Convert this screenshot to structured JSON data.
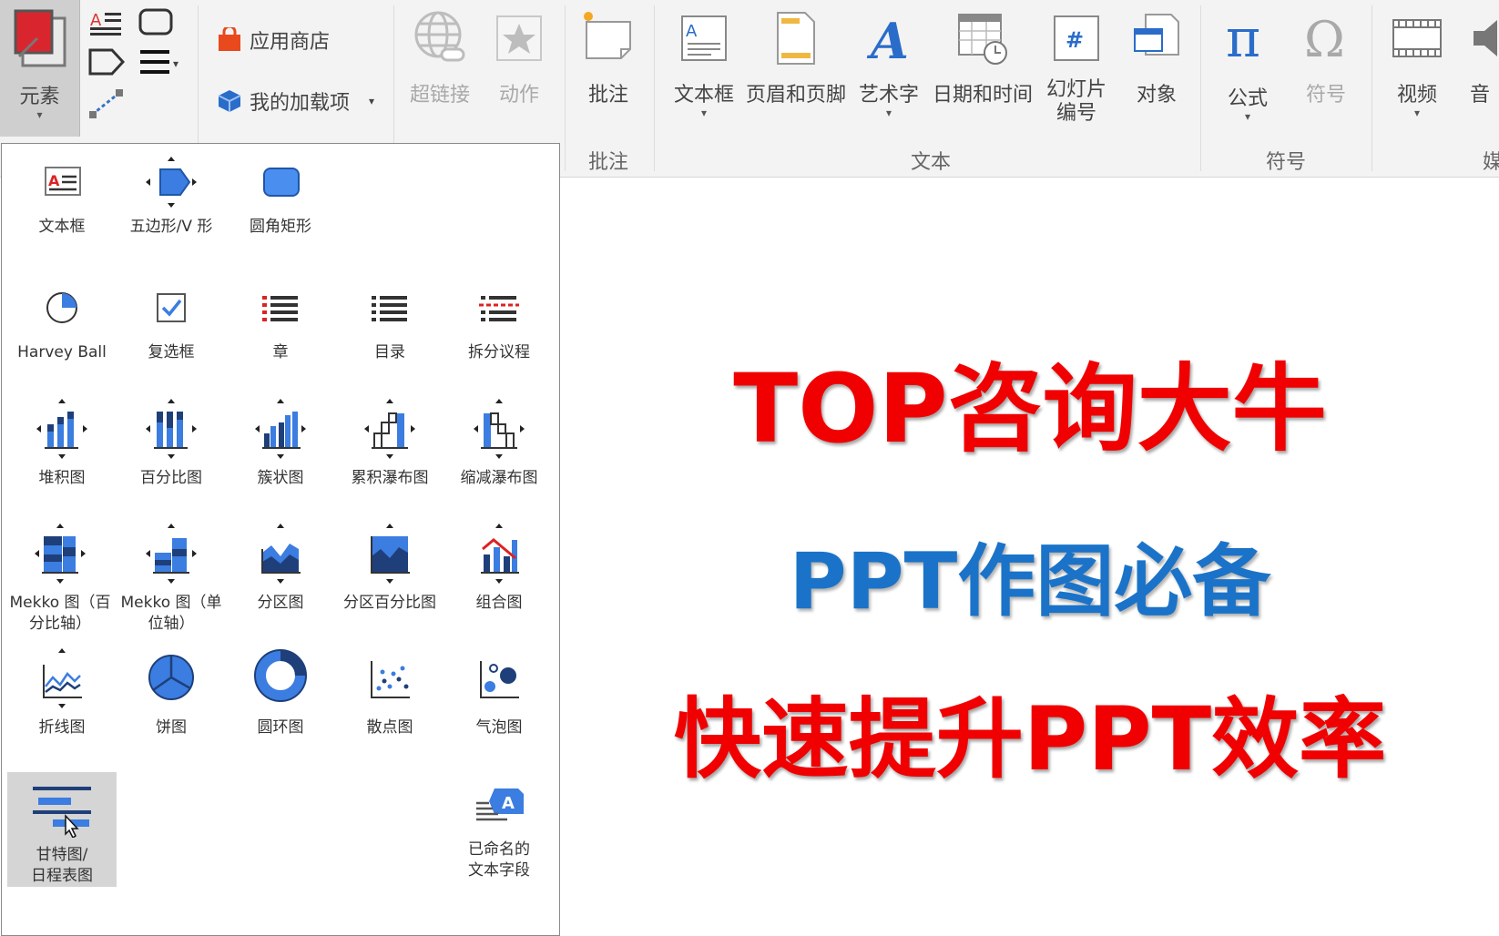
{
  "ribbon": {
    "elements_label": "元素",
    "app_store_label": "应用商店",
    "my_addins_label": "我的加载项",
    "hyperlink_label": "超链接",
    "action_label": "动作",
    "comment_label": "批注",
    "comment_group": "批注",
    "textbox_label": "文本框",
    "header_footer_label": "页眉和页脚",
    "wordart_label": "艺术字",
    "datetime_label": "日期和时间",
    "slide_number_label": "幻灯片\n编号",
    "object_label": "对象",
    "text_group": "文本",
    "equation_label": "公式",
    "symbol_label": "符号",
    "symbols_group": "符号",
    "video_label": "视频",
    "audio_label": "音",
    "media_group": "媒"
  },
  "panel": {
    "items": [
      {
        "label": "文本框",
        "icon": "textbox-icon"
      },
      {
        "label": "五边形/V 形",
        "icon": "pentagon-chevron-icon"
      },
      {
        "label": "圆角矩形",
        "icon": "rounded-rectangle-icon"
      },
      {
        "label": "Harvey Ball",
        "icon": "harvey-ball-icon"
      },
      {
        "label": "复选框",
        "icon": "checkbox-icon"
      },
      {
        "label": "章",
        "icon": "chapter-icon"
      },
      {
        "label": "目录",
        "icon": "table-of-contents-icon"
      },
      {
        "label": "拆分议程",
        "icon": "split-agenda-icon"
      },
      {
        "label": "堆积图",
        "icon": "stacked-chart-icon"
      },
      {
        "label": "百分比图",
        "icon": "percent-chart-icon"
      },
      {
        "label": "簇状图",
        "icon": "clustered-chart-icon"
      },
      {
        "label": "累积瀑布图",
        "icon": "waterfall-up-icon"
      },
      {
        "label": "缩减瀑布图",
        "icon": "waterfall-down-icon"
      },
      {
        "label": "Mekko 图（百分比轴）",
        "icon": "mekko-percent-icon"
      },
      {
        "label": "Mekko 图（单位轴）",
        "icon": "mekko-unit-icon"
      },
      {
        "label": "分区图",
        "icon": "area-chart-icon"
      },
      {
        "label": "分区百分比图",
        "icon": "area-percent-chart-icon"
      },
      {
        "label": "组合图",
        "icon": "combo-chart-icon"
      },
      {
        "label": "折线图",
        "icon": "line-chart-icon"
      },
      {
        "label": "饼图",
        "icon": "pie-chart-icon"
      },
      {
        "label": "圆环图",
        "icon": "doughnut-chart-icon"
      },
      {
        "label": "散点图",
        "icon": "scatter-chart-icon"
      },
      {
        "label": "气泡图",
        "icon": "bubble-chart-icon"
      },
      {
        "label": "甘特图/\n日程表图",
        "icon": "gantt-chart-icon"
      },
      {
        "label": "已命名的\n文本字段",
        "icon": "named-text-field-icon"
      }
    ]
  },
  "slide": {
    "line1": "TOP咨询大牛",
    "line2": "PPT作图必备",
    "line3": "快速提升PPT效率"
  },
  "colors": {
    "accent_red": "#f00000",
    "accent_blue": "#1a73c8",
    "icon_blue": "#3b6fc4"
  }
}
